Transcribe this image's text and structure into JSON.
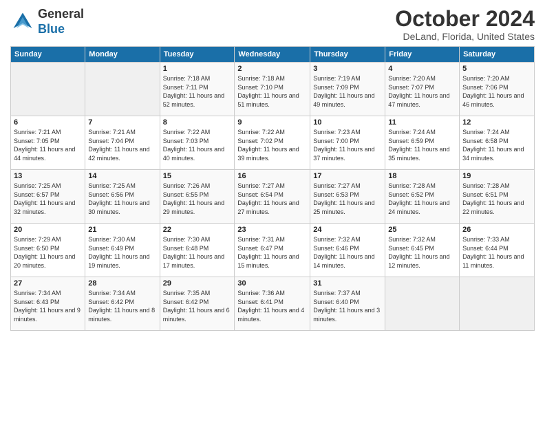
{
  "header": {
    "logo_line1": "General",
    "logo_line2": "Blue",
    "month": "October 2024",
    "location": "DeLand, Florida, United States"
  },
  "days_of_week": [
    "Sunday",
    "Monday",
    "Tuesday",
    "Wednesday",
    "Thursday",
    "Friday",
    "Saturday"
  ],
  "weeks": [
    [
      {
        "day": "",
        "sunrise": "",
        "sunset": "",
        "daylight": ""
      },
      {
        "day": "",
        "sunrise": "",
        "sunset": "",
        "daylight": ""
      },
      {
        "day": "1",
        "sunrise": "Sunrise: 7:18 AM",
        "sunset": "Sunset: 7:11 PM",
        "daylight": "Daylight: 11 hours and 52 minutes."
      },
      {
        "day": "2",
        "sunrise": "Sunrise: 7:18 AM",
        "sunset": "Sunset: 7:10 PM",
        "daylight": "Daylight: 11 hours and 51 minutes."
      },
      {
        "day": "3",
        "sunrise": "Sunrise: 7:19 AM",
        "sunset": "Sunset: 7:09 PM",
        "daylight": "Daylight: 11 hours and 49 minutes."
      },
      {
        "day": "4",
        "sunrise": "Sunrise: 7:20 AM",
        "sunset": "Sunset: 7:07 PM",
        "daylight": "Daylight: 11 hours and 47 minutes."
      },
      {
        "day": "5",
        "sunrise": "Sunrise: 7:20 AM",
        "sunset": "Sunset: 7:06 PM",
        "daylight": "Daylight: 11 hours and 46 minutes."
      }
    ],
    [
      {
        "day": "6",
        "sunrise": "Sunrise: 7:21 AM",
        "sunset": "Sunset: 7:05 PM",
        "daylight": "Daylight: 11 hours and 44 minutes."
      },
      {
        "day": "7",
        "sunrise": "Sunrise: 7:21 AM",
        "sunset": "Sunset: 7:04 PM",
        "daylight": "Daylight: 11 hours and 42 minutes."
      },
      {
        "day": "8",
        "sunrise": "Sunrise: 7:22 AM",
        "sunset": "Sunset: 7:03 PM",
        "daylight": "Daylight: 11 hours and 40 minutes."
      },
      {
        "day": "9",
        "sunrise": "Sunrise: 7:22 AM",
        "sunset": "Sunset: 7:02 PM",
        "daylight": "Daylight: 11 hours and 39 minutes."
      },
      {
        "day": "10",
        "sunrise": "Sunrise: 7:23 AM",
        "sunset": "Sunset: 7:00 PM",
        "daylight": "Daylight: 11 hours and 37 minutes."
      },
      {
        "day": "11",
        "sunrise": "Sunrise: 7:24 AM",
        "sunset": "Sunset: 6:59 PM",
        "daylight": "Daylight: 11 hours and 35 minutes."
      },
      {
        "day": "12",
        "sunrise": "Sunrise: 7:24 AM",
        "sunset": "Sunset: 6:58 PM",
        "daylight": "Daylight: 11 hours and 34 minutes."
      }
    ],
    [
      {
        "day": "13",
        "sunrise": "Sunrise: 7:25 AM",
        "sunset": "Sunset: 6:57 PM",
        "daylight": "Daylight: 11 hours and 32 minutes."
      },
      {
        "day": "14",
        "sunrise": "Sunrise: 7:25 AM",
        "sunset": "Sunset: 6:56 PM",
        "daylight": "Daylight: 11 hours and 30 minutes."
      },
      {
        "day": "15",
        "sunrise": "Sunrise: 7:26 AM",
        "sunset": "Sunset: 6:55 PM",
        "daylight": "Daylight: 11 hours and 29 minutes."
      },
      {
        "day": "16",
        "sunrise": "Sunrise: 7:27 AM",
        "sunset": "Sunset: 6:54 PM",
        "daylight": "Daylight: 11 hours and 27 minutes."
      },
      {
        "day": "17",
        "sunrise": "Sunrise: 7:27 AM",
        "sunset": "Sunset: 6:53 PM",
        "daylight": "Daylight: 11 hours and 25 minutes."
      },
      {
        "day": "18",
        "sunrise": "Sunrise: 7:28 AM",
        "sunset": "Sunset: 6:52 PM",
        "daylight": "Daylight: 11 hours and 24 minutes."
      },
      {
        "day": "19",
        "sunrise": "Sunrise: 7:28 AM",
        "sunset": "Sunset: 6:51 PM",
        "daylight": "Daylight: 11 hours and 22 minutes."
      }
    ],
    [
      {
        "day": "20",
        "sunrise": "Sunrise: 7:29 AM",
        "sunset": "Sunset: 6:50 PM",
        "daylight": "Daylight: 11 hours and 20 minutes."
      },
      {
        "day": "21",
        "sunrise": "Sunrise: 7:30 AM",
        "sunset": "Sunset: 6:49 PM",
        "daylight": "Daylight: 11 hours and 19 minutes."
      },
      {
        "day": "22",
        "sunrise": "Sunrise: 7:30 AM",
        "sunset": "Sunset: 6:48 PM",
        "daylight": "Daylight: 11 hours and 17 minutes."
      },
      {
        "day": "23",
        "sunrise": "Sunrise: 7:31 AM",
        "sunset": "Sunset: 6:47 PM",
        "daylight": "Daylight: 11 hours and 15 minutes."
      },
      {
        "day": "24",
        "sunrise": "Sunrise: 7:32 AM",
        "sunset": "Sunset: 6:46 PM",
        "daylight": "Daylight: 11 hours and 14 minutes."
      },
      {
        "day": "25",
        "sunrise": "Sunrise: 7:32 AM",
        "sunset": "Sunset: 6:45 PM",
        "daylight": "Daylight: 11 hours and 12 minutes."
      },
      {
        "day": "26",
        "sunrise": "Sunrise: 7:33 AM",
        "sunset": "Sunset: 6:44 PM",
        "daylight": "Daylight: 11 hours and 11 minutes."
      }
    ],
    [
      {
        "day": "27",
        "sunrise": "Sunrise: 7:34 AM",
        "sunset": "Sunset: 6:43 PM",
        "daylight": "Daylight: 11 hours and 9 minutes."
      },
      {
        "day": "28",
        "sunrise": "Sunrise: 7:34 AM",
        "sunset": "Sunset: 6:42 PM",
        "daylight": "Daylight: 11 hours and 8 minutes."
      },
      {
        "day": "29",
        "sunrise": "Sunrise: 7:35 AM",
        "sunset": "Sunset: 6:42 PM",
        "daylight": "Daylight: 11 hours and 6 minutes."
      },
      {
        "day": "30",
        "sunrise": "Sunrise: 7:36 AM",
        "sunset": "Sunset: 6:41 PM",
        "daylight": "Daylight: 11 hours and 4 minutes."
      },
      {
        "day": "31",
        "sunrise": "Sunrise: 7:37 AM",
        "sunset": "Sunset: 6:40 PM",
        "daylight": "Daylight: 11 hours and 3 minutes."
      },
      {
        "day": "",
        "sunrise": "",
        "sunset": "",
        "daylight": ""
      },
      {
        "day": "",
        "sunrise": "",
        "sunset": "",
        "daylight": ""
      }
    ]
  ]
}
